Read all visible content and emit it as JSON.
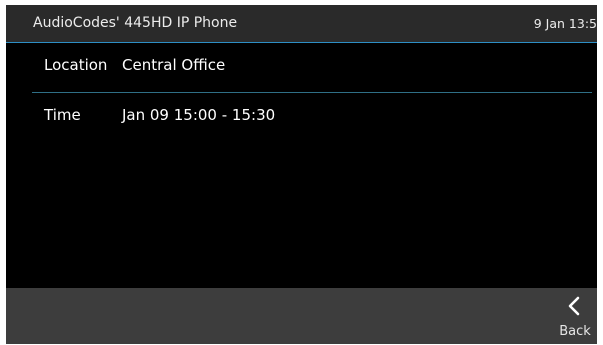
{
  "header": {
    "title": "AudioCodes' 445HD IP Phone",
    "clock": "9 Jan 13:5"
  },
  "details": [
    {
      "label": "Location",
      "value": "Central Office"
    },
    {
      "label": "Time",
      "value": "Jan 09 15:00 - 15:30"
    }
  ],
  "softkeys": {
    "back_label": "Back",
    "back_icon": "chevron-left-icon"
  },
  "colors": {
    "header_background": "#2a2a2a",
    "header_accent_line": "#2d8ec4",
    "row_divider": "#2f6f86",
    "screen_background": "#000000",
    "softkey_bar": "#3d3d3d",
    "text": "#ffffff"
  }
}
